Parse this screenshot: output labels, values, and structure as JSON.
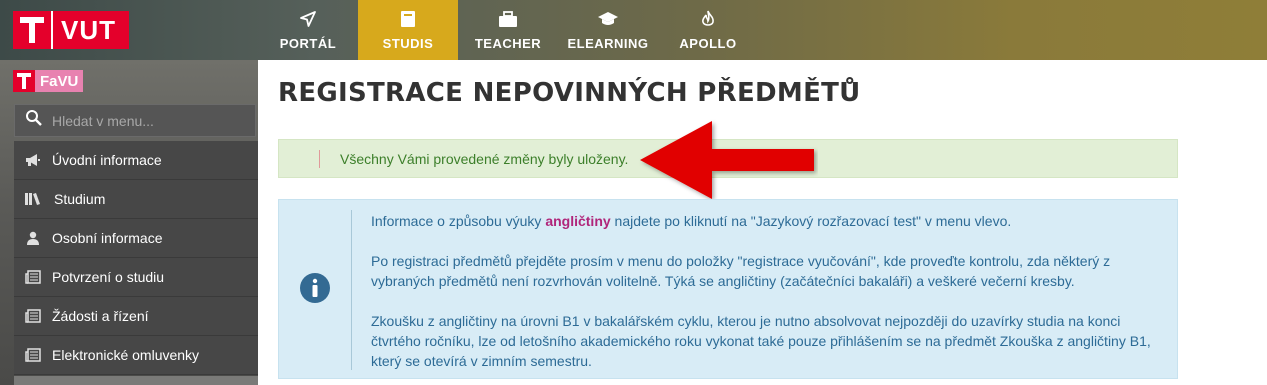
{
  "brand": {
    "logo_text": "VUT",
    "faculty": "FaVU"
  },
  "nav": [
    {
      "label": "PORTÁL",
      "icon": "paper-plane-icon"
    },
    {
      "label": "STUDIS",
      "icon": "book-icon",
      "active": true
    },
    {
      "label": "TEACHER",
      "icon": "briefcase-icon"
    },
    {
      "label": "ELEARNING",
      "icon": "graduation-cap-icon"
    },
    {
      "label": "APOLLO",
      "icon": "flame-icon"
    }
  ],
  "sidebar": {
    "search_placeholder": "Hledat v menu...",
    "items": [
      {
        "label": "Úvodní informace",
        "icon": "megaphone-icon"
      },
      {
        "label": "Studium",
        "icon": "books-icon"
      },
      {
        "label": "Osobní informace",
        "icon": "user-icon"
      },
      {
        "label": "Potvrzení o studiu",
        "icon": "newspaper-icon"
      },
      {
        "label": "Žádosti a řízení",
        "icon": "newspaper-icon"
      },
      {
        "label": "Elektronické omluvenky",
        "icon": "newspaper-icon"
      }
    ]
  },
  "main": {
    "title": "REGISTRACE NEPOVINNÝCH PŘEDMĚTŮ",
    "success_message": "Všechny Vámi provedené změny byly uloženy.",
    "info": {
      "p1_before": "Informace o způsobu výuky ",
      "p1_bold": "angličtiny",
      "p1_after": " najdete po kliknutí na \"Jazykový rozřazovací test\" v menu vlevo.",
      "p2": "Po registraci předmětů přejděte prosím v menu do položky \"registrace vyučování\", kde proveďte kontrolu, zda některý z vybraných předmětů není rozvrhován volitelně. Týká se angličtiny (začátečníci bakaláři) a veškeré večerní kresby.",
      "p3": "Zkoušku z angličtiny na úrovni B1 v bakalářském cyklu, kterou je nutno absolvovat nejpozději do uzavírky studia na konci čtvrtého ročníku, lze od letošního akademického roku vykonat také pouze přihlášením se na předmět Zkouška z angličtiny B1, který se otevírá v zimním semestru."
    }
  },
  "colors": {
    "brand_red": "#e4002b",
    "active_tab": "#d7a91c",
    "success_text": "#3c7f2a",
    "info_text": "#2d6b96",
    "highlight": "#b0257a"
  }
}
